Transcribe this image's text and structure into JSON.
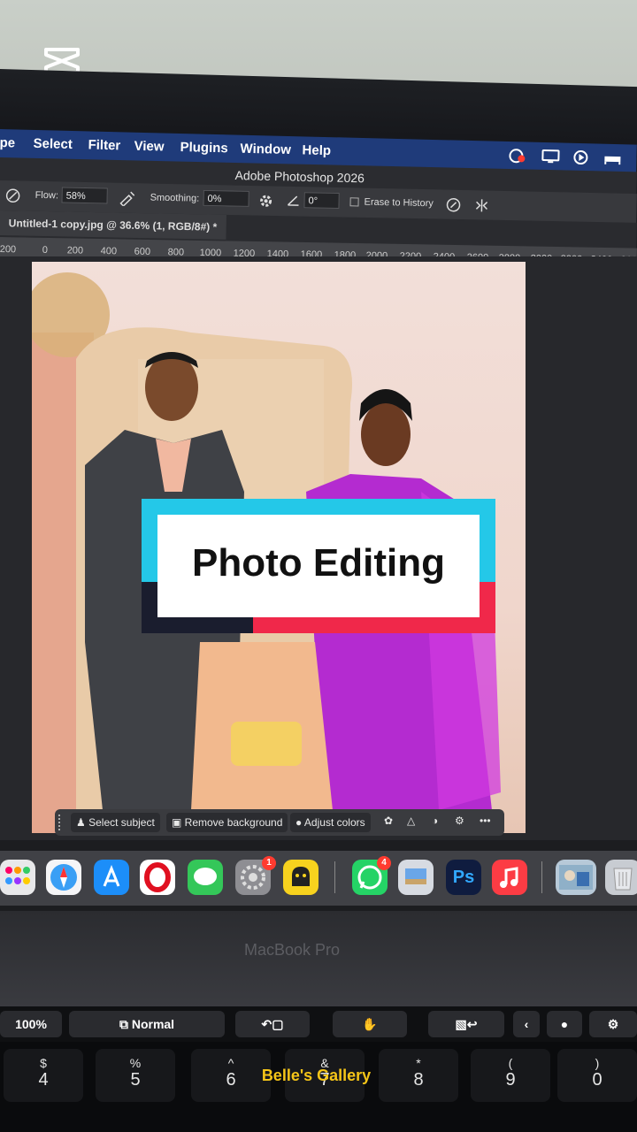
{
  "menubar": {
    "items": [
      "pe",
      "Select",
      "Filter",
      "View",
      "Plugins",
      "Window",
      "Help"
    ]
  },
  "app_title": "Adobe Photoshop 2026",
  "options_bar": {
    "flow_label": "Flow:",
    "flow_value": "58%",
    "smoothing_label": "Smoothing:",
    "smoothing_value": "0%",
    "angle_value": "0°",
    "erase_to_history": "Erase to History"
  },
  "document_tab": {
    "label": "Untitled-1 copy.jpg @ 36.6% (1, RGB/8#) *"
  },
  "ruler": {
    "ticks": [
      "200",
      "0",
      "200",
      "400",
      "600",
      "800",
      "1000",
      "1200",
      "1400",
      "1600",
      "1800",
      "2000",
      "2200",
      "2400",
      "2600",
      "2800",
      "3000",
      "3200",
      "3400",
      "360"
    ]
  },
  "context_bar": {
    "select_subject": "Select subject",
    "remove_background": "Remove background",
    "adjust_colors": "Adjust colors",
    "more": "•••"
  },
  "overlay_title": "Photo Editing",
  "dock": {
    "settings_badge": "1",
    "whatsapp_badge": "4",
    "photoshop_label": "Ps"
  },
  "laptop_label": "MacBook Pro",
  "touchbar": {
    "zoom": "100%",
    "blend_mode": "Normal"
  },
  "keys": [
    {
      "top": "$",
      "bottom": "4"
    },
    {
      "top": "%",
      "bottom": "5"
    },
    {
      "top": "^",
      "bottom": "6"
    },
    {
      "top": "&",
      "bottom": "7"
    },
    {
      "top": "*",
      "bottom": "8"
    },
    {
      "top": "(",
      "bottom": "9"
    },
    {
      "top": ")",
      "bottom": "0"
    }
  ],
  "watermark": "Belle's Gallery",
  "colors": {
    "overlay_cyan": "#24c8e8",
    "overlay_red": "#f0284a",
    "overlay_navy": "#1a1d2e",
    "menubar_blue": "#1f3b7a",
    "watermark_yellow": "#f5c518"
  }
}
